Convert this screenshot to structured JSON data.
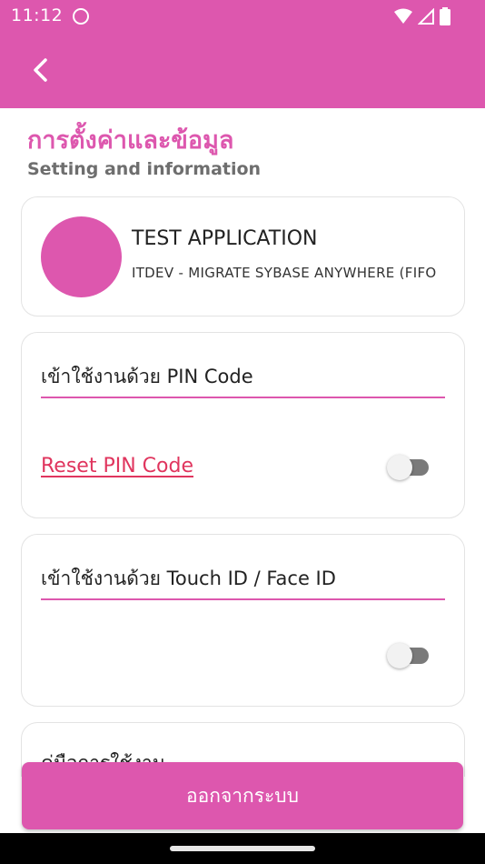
{
  "statusbar": {
    "time": "11:12",
    "icons": [
      "app-notification-icon",
      "wifi-icon",
      "signal-icon",
      "battery-icon"
    ]
  },
  "appbar": {
    "back_icon": "chevron-left-icon"
  },
  "page": {
    "title_th": "การตั้งค่าและข้อมูล",
    "title_en": "Setting and information"
  },
  "profile": {
    "app_name": "TEST APPLICATION",
    "app_description": "ITDEV - MIGRATE SYBASE ANYWHERE (FIFO"
  },
  "pin_section": {
    "label": "เข้าใช้งานด้วย PIN Code",
    "reset_link": "Reset PIN Code",
    "toggle_on": false
  },
  "touch_section": {
    "label": "เข้าใช้งานด้วย Touch ID / Face ID",
    "toggle_on": false
  },
  "more_section": {
    "label": "คู่มือการใช้งาน"
  },
  "footer": {
    "logout_label": "ออกจากระบบ"
  },
  "colors": {
    "brand_pink": "#dd57ae",
    "link_red": "#e0355e"
  }
}
